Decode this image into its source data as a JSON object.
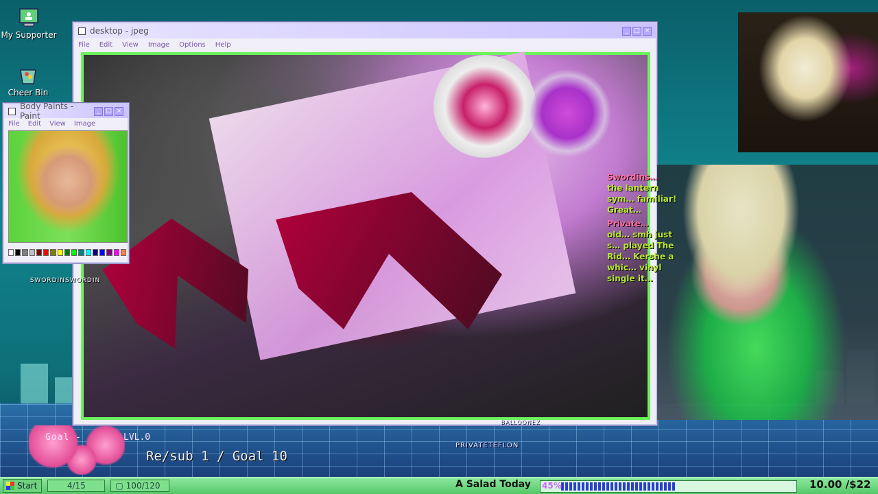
{
  "desktop": {
    "icons": [
      {
        "label": "My Supporter"
      },
      {
        "label": "Cheer Bin"
      }
    ]
  },
  "main_window": {
    "title": "desktop - jpeg",
    "menu": [
      "File",
      "Edit",
      "View",
      "Image",
      "Options",
      "Help"
    ],
    "buttons": {
      "minimize": "_",
      "maximize": "□",
      "close": "×"
    }
  },
  "paint_window": {
    "title": "Body Paints - Paint",
    "menu": [
      "File",
      "Edit",
      "View",
      "Image"
    ],
    "artist": "SWORDINSWORDIN",
    "palette_colors": [
      "#ffffff",
      "#000000",
      "#808080",
      "#c0c0c0",
      "#800000",
      "#ff0000",
      "#808000",
      "#ffff00",
      "#008000",
      "#00ff00",
      "#008080",
      "#00ffff",
      "#000080",
      "#0000ff",
      "#800080",
      "#ff00ff",
      "#ff8040"
    ]
  },
  "chat": {
    "messages": [
      {
        "user": "Swordins…",
        "text": "the lantern sym… familiar! Great…"
      },
      {
        "user": "Private…",
        "text": "old… smh just s… played The Rid… Kershe a whic… vinyl single it…"
      }
    ]
  },
  "hud": {
    "goal_label": "Goal -",
    "level": "LVL.0",
    "goal_text": "Re/sub 1 / Goal 10",
    "donor_top": "BALLOONEZ",
    "donor": "PRIVATETEFLON"
  },
  "taskbar": {
    "start_label": "Start",
    "counter": "4/15",
    "hp": "100/120",
    "goal_title": "A Salad Today",
    "progress": {
      "percent_label": "45%",
      "fraction": 0.45
    },
    "amount": "10.00 /$22"
  }
}
